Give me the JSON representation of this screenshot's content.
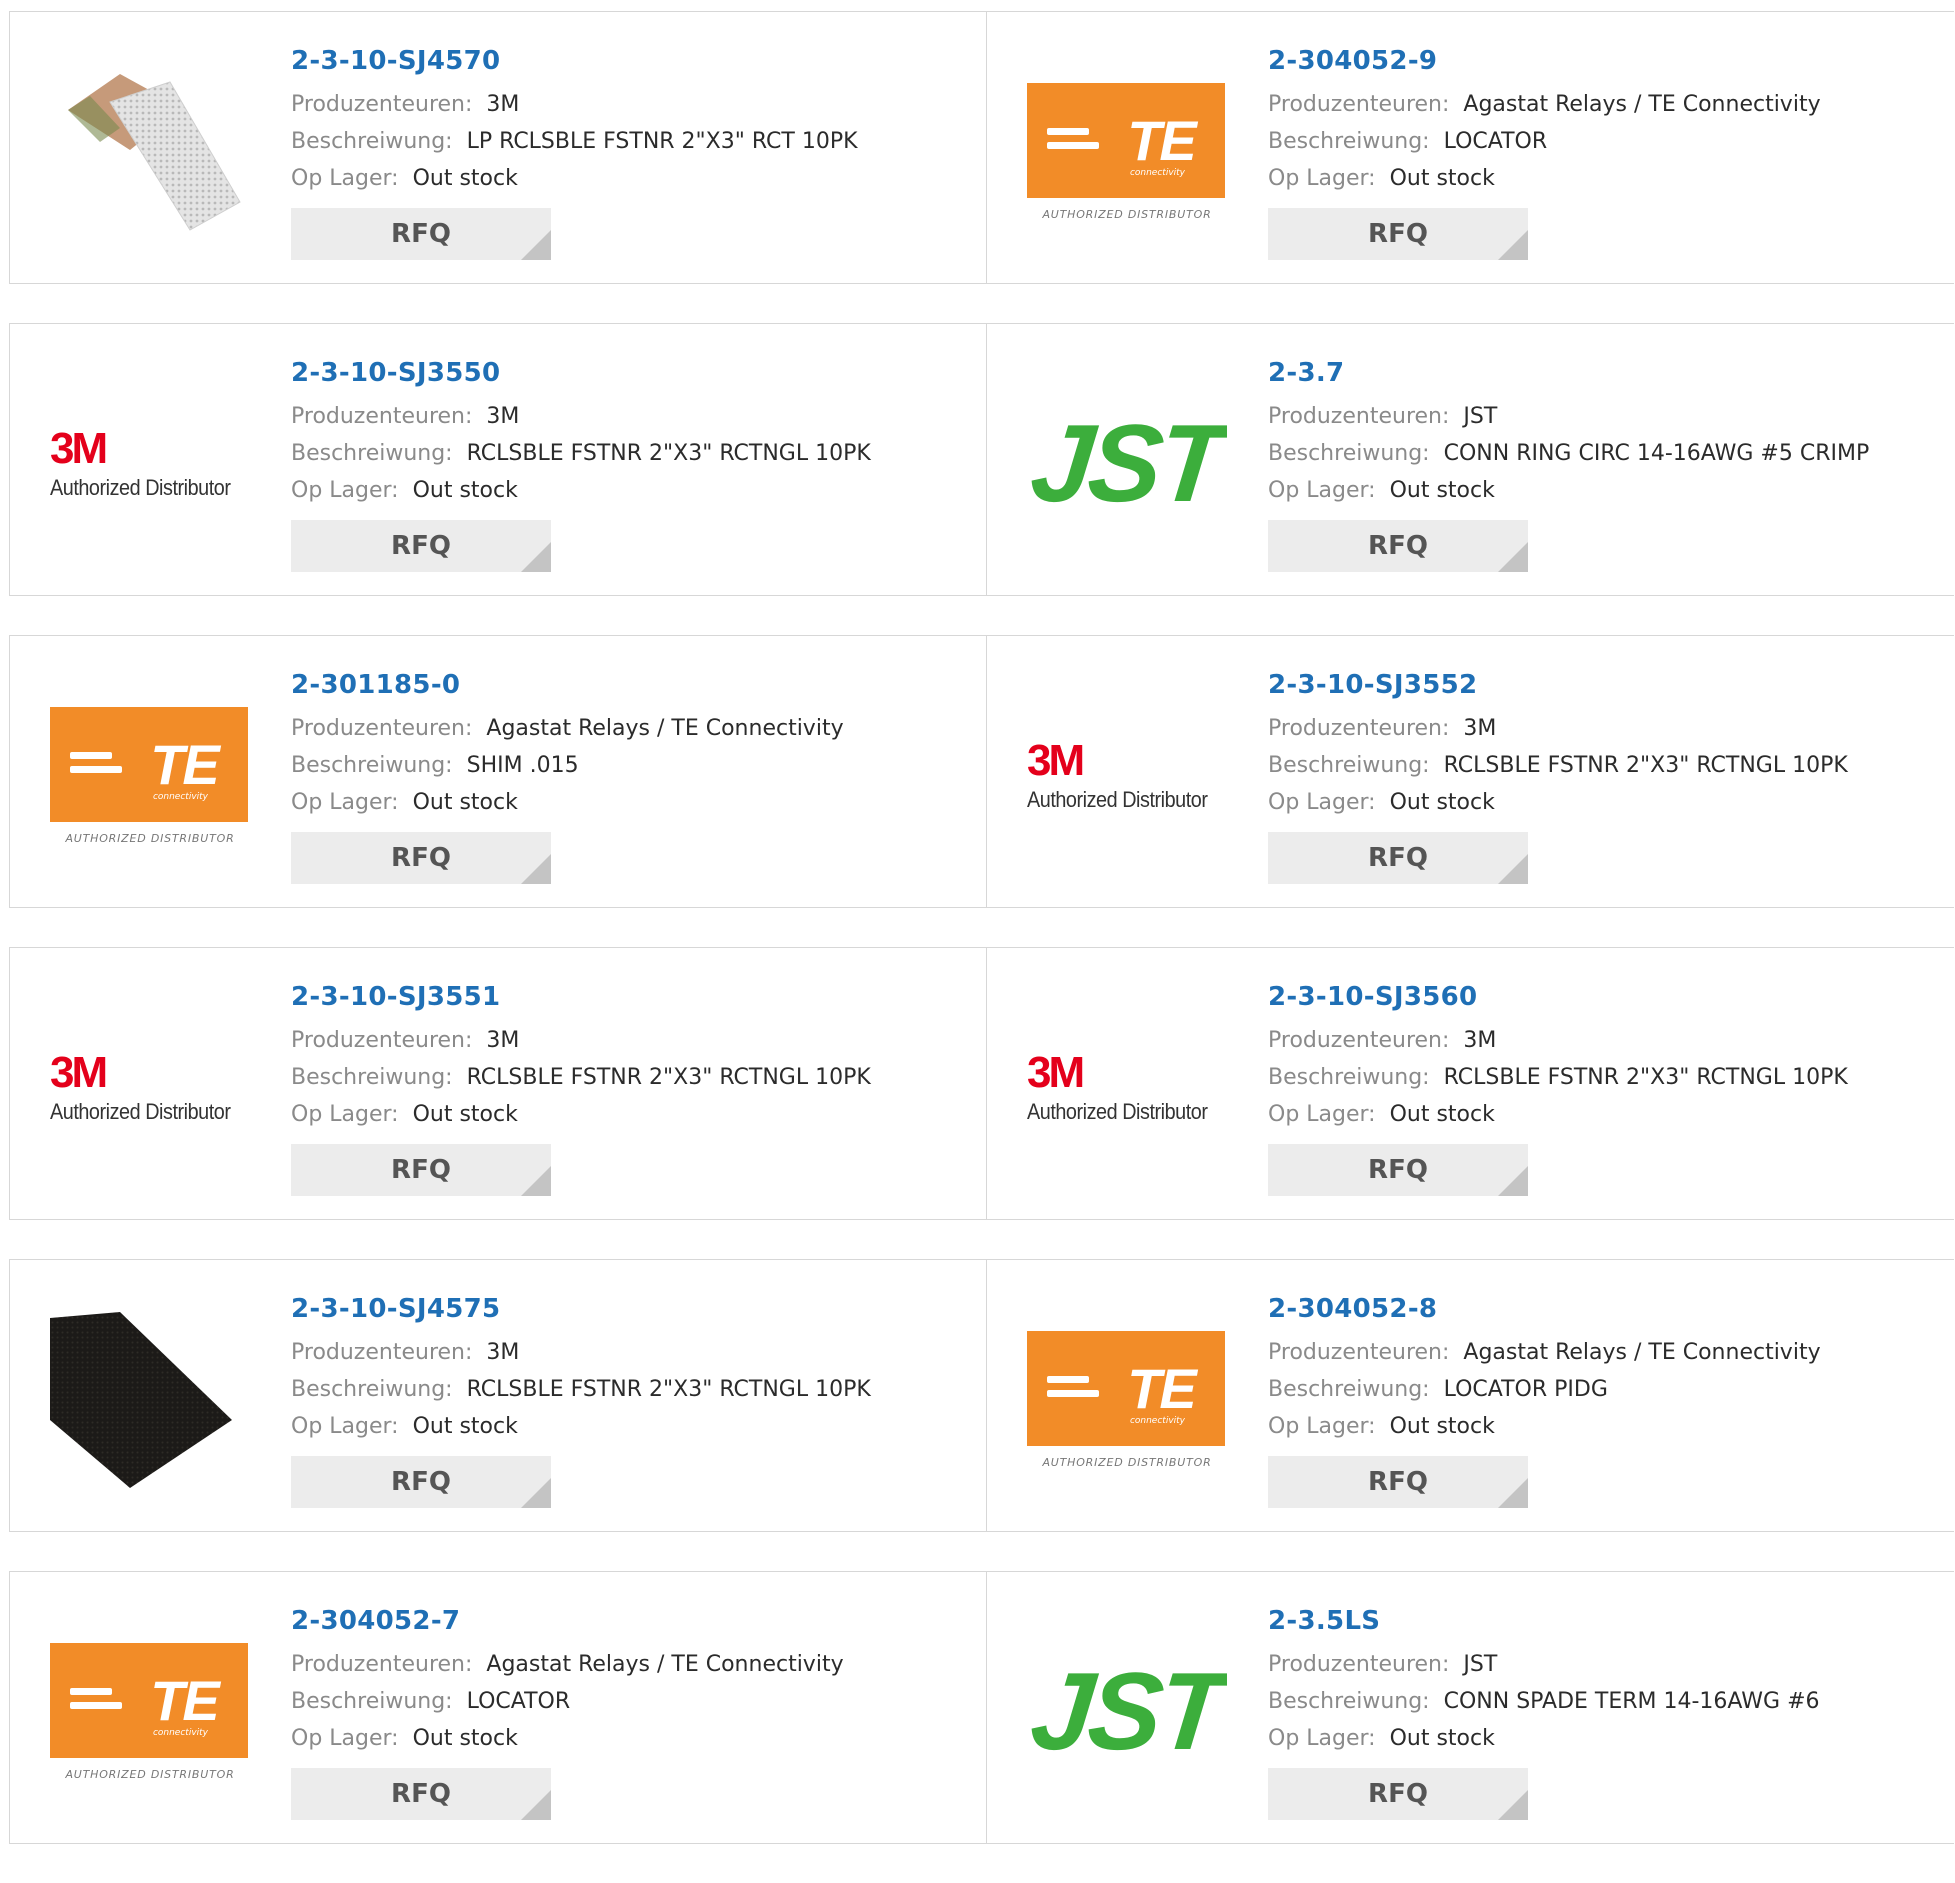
{
  "labels": {
    "manufacturer": "Produzenteuren:",
    "description": "Beschreiwung:",
    "stock": "Op Lager:",
    "rfq": "RFQ"
  },
  "logos": {
    "m3": {
      "mark": "3M",
      "caption": "Authorized Distributor"
    },
    "te": {
      "mark": "TE",
      "sub": "connectivity",
      "caption": "AUTHORIZED DISTRIBUTOR"
    },
    "jst": {
      "mark": "JST"
    }
  },
  "colors": {
    "link": "#1f6fb5",
    "te_orange": "#f28c28",
    "jst_green": "#3cae3c",
    "m3_red": "#e4001b"
  },
  "products": [
    {
      "part": "2-3-10-SJ4570",
      "manufacturer": "3M",
      "description": "LP RCLSBLE FSTNR 2\"X3\" RCT 10PK",
      "stock": "Out stock",
      "image": "tape-photo"
    },
    {
      "part": "2-304052-9",
      "manufacturer": "Agastat Relays / TE Connectivity",
      "description": "LOCATOR",
      "stock": "Out stock",
      "image": "te-logo"
    },
    {
      "part": "2-3-10-SJ3550",
      "manufacturer": "3M",
      "description": "RCLSBLE FSTNR 2\"X3\" RCTNGL 10PK",
      "stock": "Out stock",
      "image": "3m-logo"
    },
    {
      "part": "2-3.7",
      "manufacturer": "JST",
      "description": "CONN RING CIRC 14-16AWG #5 CRIMP",
      "stock": "Out stock",
      "image": "jst-logo"
    },
    {
      "part": "2-301185-0",
      "manufacturer": "Agastat Relays / TE Connectivity",
      "description": "SHIM .015",
      "stock": "Out stock",
      "image": "te-logo"
    },
    {
      "part": "2-3-10-SJ3552",
      "manufacturer": "3M",
      "description": "RCLSBLE FSTNR 2\"X3\" RCTNGL 10PK",
      "stock": "Out stock",
      "image": "3m-logo"
    },
    {
      "part": "2-3-10-SJ3551",
      "manufacturer": "3M",
      "description": "RCLSBLE FSTNR 2\"X3\" RCTNGL 10PK",
      "stock": "Out stock",
      "image": "3m-logo"
    },
    {
      "part": "2-3-10-SJ3560",
      "manufacturer": "3M",
      "description": "RCLSBLE FSTNR 2\"X3\" RCTNGL 10PK",
      "stock": "Out stock",
      "image": "3m-logo"
    },
    {
      "part": "2-3-10-SJ4575",
      "manufacturer": "3M",
      "description": "RCLSBLE FSTNR 2\"X3\" RCTNGL 10PK",
      "stock": "Out stock",
      "image": "black-strip-photo"
    },
    {
      "part": "2-304052-8",
      "manufacturer": "Agastat Relays / TE Connectivity",
      "description": "LOCATOR PIDG",
      "stock": "Out stock",
      "image": "te-logo"
    },
    {
      "part": "2-304052-7",
      "manufacturer": "Agastat Relays / TE Connectivity",
      "description": "LOCATOR",
      "stock": "Out stock",
      "image": "te-logo"
    },
    {
      "part": "2-3.5LS",
      "manufacturer": "JST",
      "description": "CONN SPADE TERM 14-16AWG #6",
      "stock": "Out stock",
      "image": "jst-logo"
    }
  ]
}
